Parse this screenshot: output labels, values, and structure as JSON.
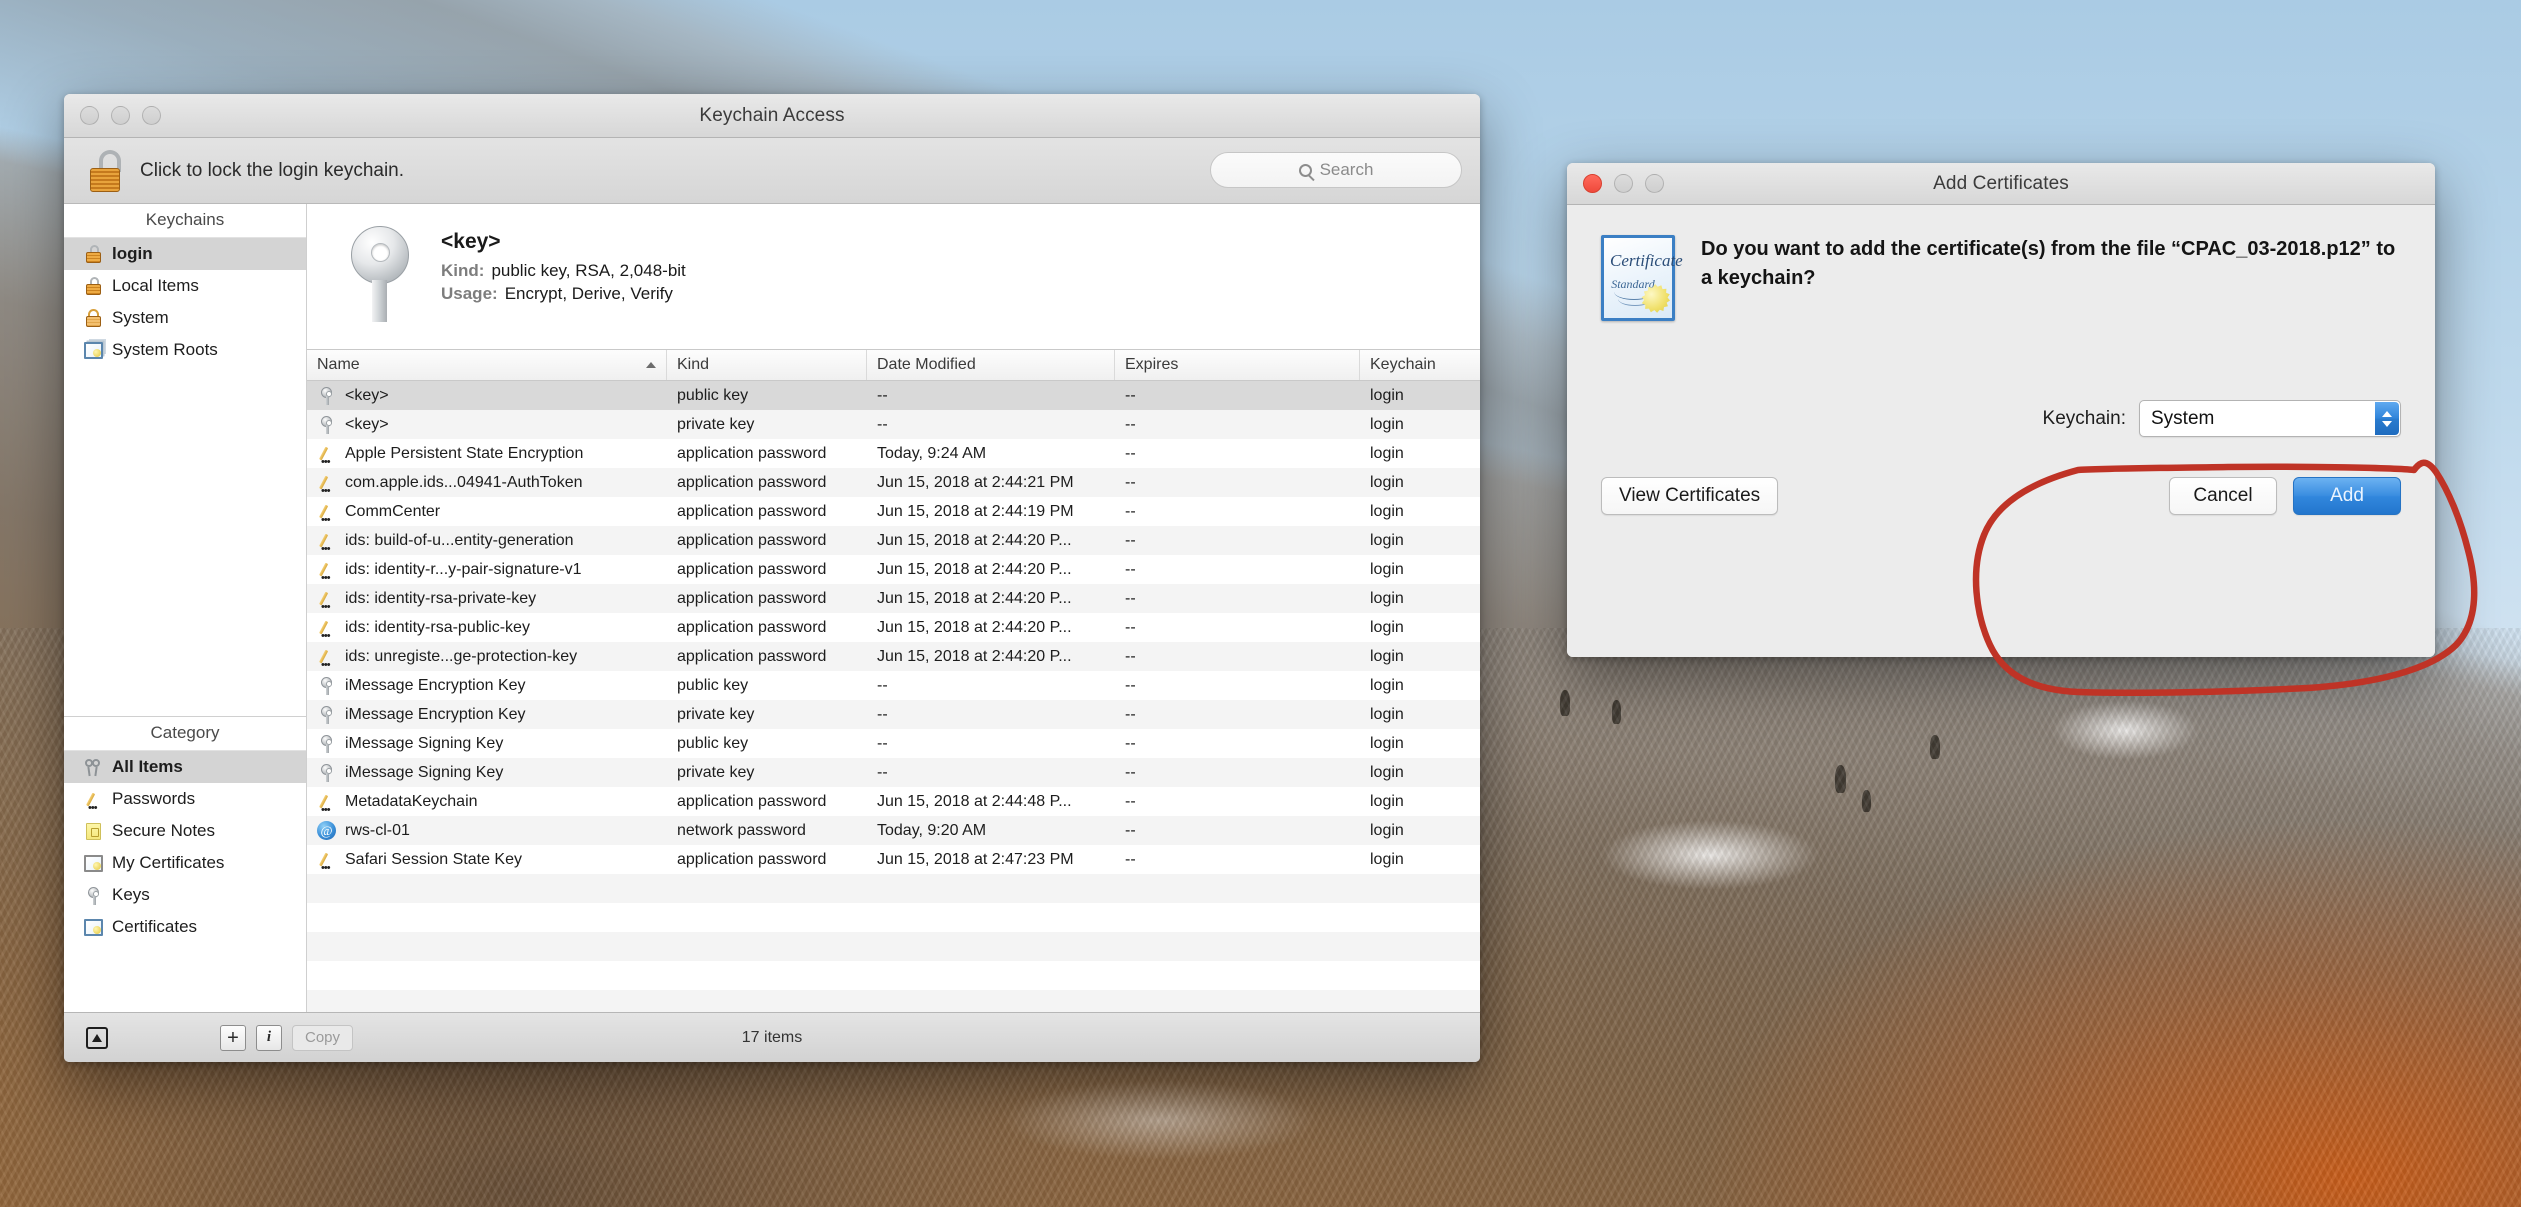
{
  "desktop": {
    "wallpaper_name": "mountain-landscape"
  },
  "keychain_window": {
    "title": "Keychain Access",
    "traffic_lights": [
      "close",
      "minimize",
      "zoom"
    ],
    "toolbar": {
      "lock_icon": "unlocked-padlock-icon",
      "lock_label": "Click to lock the login keychain.",
      "search_placeholder": "Search",
      "search_icon": "search-icon"
    },
    "sidebar": {
      "keychains_header": "Keychains",
      "keychains": [
        {
          "label": "login",
          "icon": "lock-open-icon",
          "selected": true
        },
        {
          "label": "Local Items",
          "icon": "lock-open-icon",
          "selected": false
        },
        {
          "label": "System",
          "icon": "lock-closed-icon",
          "selected": false
        },
        {
          "label": "System Roots",
          "icon": "certificate-stack-icon",
          "selected": false
        }
      ],
      "category_header": "Category",
      "categories": [
        {
          "label": "All Items",
          "icon": "keys-icon",
          "selected": true
        },
        {
          "label": "Passwords",
          "icon": "pencil-icon",
          "selected": false
        },
        {
          "label": "Secure Notes",
          "icon": "secure-note-icon",
          "selected": false
        },
        {
          "label": "My Certificates",
          "icon": "certificate-icon",
          "selected": false
        },
        {
          "label": "Keys",
          "icon": "key-icon",
          "selected": false
        },
        {
          "label": "Certificates",
          "icon": "certificate-icon",
          "selected": false
        }
      ]
    },
    "detail": {
      "icon": "key-icon",
      "title": "<key>",
      "rows": [
        {
          "label": "Kind:",
          "value": "public key, RSA, 2,048-bit"
        },
        {
          "label": "Usage:",
          "value": "Encrypt, Derive, Verify"
        }
      ]
    },
    "table": {
      "columns": [
        "Name",
        "Kind",
        "Date Modified",
        "Expires",
        "Keychain"
      ],
      "sort_column": "Name",
      "sort_direction": "ascending",
      "rows": [
        {
          "icon": "key-icon",
          "name": "<key>",
          "kind": "public key",
          "date": "--",
          "expires": "--",
          "keychain": "login",
          "selected": true
        },
        {
          "icon": "key-icon",
          "name": "<key>",
          "kind": "private key",
          "date": "--",
          "expires": "--",
          "keychain": "login",
          "selected": false
        },
        {
          "icon": "pencil-icon",
          "name": "Apple Persistent State Encryption",
          "kind": "application password",
          "date": "Today, 9:24 AM",
          "expires": "--",
          "keychain": "login",
          "selected": false
        },
        {
          "icon": "pencil-icon",
          "name": "com.apple.ids...04941-AuthToken",
          "kind": "application password",
          "date": "Jun 15, 2018 at 2:44:21 PM",
          "expires": "--",
          "keychain": "login",
          "selected": false
        },
        {
          "icon": "pencil-icon",
          "name": "CommCenter",
          "kind": "application password",
          "date": "Jun 15, 2018 at 2:44:19 PM",
          "expires": "--",
          "keychain": "login",
          "selected": false
        },
        {
          "icon": "pencil-icon",
          "name": "ids: build-of-u...entity-generation",
          "kind": "application password",
          "date": "Jun 15, 2018 at 2:44:20 P...",
          "expires": "--",
          "keychain": "login",
          "selected": false
        },
        {
          "icon": "pencil-icon",
          "name": "ids: identity-r...y-pair-signature-v1",
          "kind": "application password",
          "date": "Jun 15, 2018 at 2:44:20 P...",
          "expires": "--",
          "keychain": "login",
          "selected": false
        },
        {
          "icon": "pencil-icon",
          "name": "ids: identity-rsa-private-key",
          "kind": "application password",
          "date": "Jun 15, 2018 at 2:44:20 P...",
          "expires": "--",
          "keychain": "login",
          "selected": false
        },
        {
          "icon": "pencil-icon",
          "name": "ids: identity-rsa-public-key",
          "kind": "application password",
          "date": "Jun 15, 2018 at 2:44:20 P...",
          "expires": "--",
          "keychain": "login",
          "selected": false
        },
        {
          "icon": "pencil-icon",
          "name": "ids: unregiste...ge-protection-key",
          "kind": "application password",
          "date": "Jun 15, 2018 at 2:44:20 P...",
          "expires": "--",
          "keychain": "login",
          "selected": false
        },
        {
          "icon": "key-icon",
          "name": "iMessage Encryption Key",
          "kind": "public key",
          "date": "--",
          "expires": "--",
          "keychain": "login",
          "selected": false
        },
        {
          "icon": "key-icon",
          "name": "iMessage Encryption Key",
          "kind": "private key",
          "date": "--",
          "expires": "--",
          "keychain": "login",
          "selected": false
        },
        {
          "icon": "key-icon",
          "name": "iMessage Signing Key",
          "kind": "public key",
          "date": "--",
          "expires": "--",
          "keychain": "login",
          "selected": false
        },
        {
          "icon": "key-icon",
          "name": "iMessage Signing Key",
          "kind": "private key",
          "date": "--",
          "expires": "--",
          "keychain": "login",
          "selected": false
        },
        {
          "icon": "pencil-icon",
          "name": "MetadataKeychain",
          "kind": "application password",
          "date": "Jun 15, 2018 at 2:44:48 P...",
          "expires": "--",
          "keychain": "login",
          "selected": false
        },
        {
          "icon": "at-icon",
          "name": "rws-cl-01",
          "kind": "network password",
          "date": "Today, 9:20 AM",
          "expires": "--",
          "keychain": "login",
          "selected": false
        },
        {
          "icon": "pencil-icon",
          "name": "Safari Session State Key",
          "kind": "application password",
          "date": "Jun 15, 2018 at 2:47:23 PM",
          "expires": "--",
          "keychain": "login",
          "selected": false
        }
      ]
    },
    "bottom_bar": {
      "eject_icon": "eject-icon",
      "add_label": "+",
      "info_label": "i",
      "copy_label": "Copy",
      "item_count": "17 items"
    }
  },
  "add_certificates_dialog": {
    "title": "Add Certificates",
    "traffic_lights": [
      "close",
      "minimize",
      "zoom"
    ],
    "cert_icon": {
      "name": "certificate-icon",
      "title_text": "Certificate",
      "subtitle_text": "Standard"
    },
    "question": "Do you want to add the certificate(s) from the file “CPAC_03-2018.p12” to a keychain?",
    "keychain_label": "Keychain:",
    "keychain_value": "System",
    "buttons": {
      "view_certificates": "View Certificates",
      "cancel": "Cancel",
      "add": "Add"
    },
    "accent_color": "#3b8ee0"
  },
  "annotation": {
    "type": "hand-drawn-circle",
    "color": "#c0392b",
    "description": "red circle around keychain selector and buttons"
  }
}
